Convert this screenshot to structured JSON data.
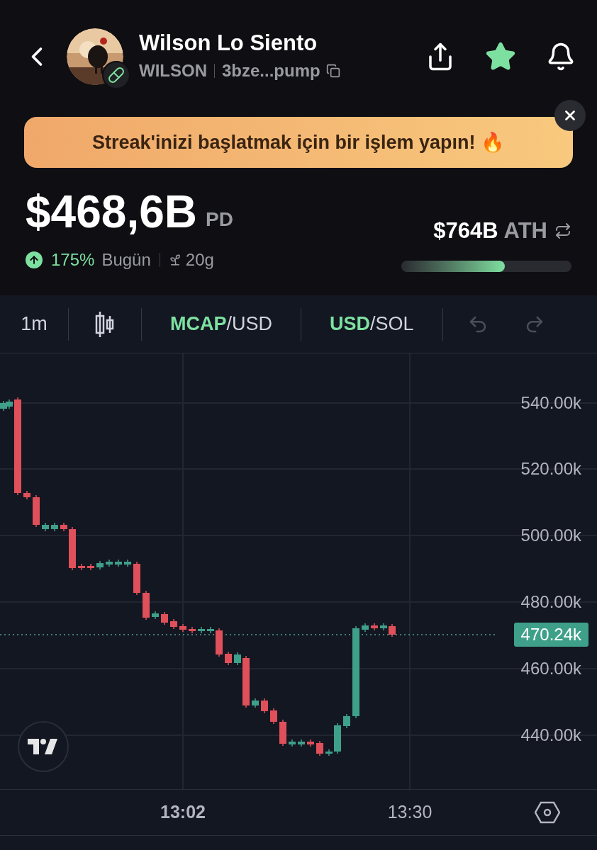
{
  "header": {
    "name": "Wilson Lo Siento",
    "ticker": "WILSON",
    "address": "3bze...pump",
    "favorite": true
  },
  "banner": {
    "text": "Streak'inizi başlatmak için bir işlem yapın! 🔥"
  },
  "stats": {
    "price": "$468,6B",
    "price_unit": "PD",
    "change": "175%",
    "change_period": "Bugün",
    "age": "20g",
    "ath_value": "$764B",
    "ath_label": "ATH",
    "ath_progress": {
      "level": 0.61
    }
  },
  "toolbar": {
    "interval": "1m",
    "pairs": [
      {
        "primary": "MCAP",
        "secondary": "/USD"
      },
      {
        "primary": "USD",
        "secondary": "/SOL"
      }
    ]
  },
  "chart": {
    "y_labels": [
      "540.00k",
      "520.00k",
      "500.00k",
      "480.00k",
      "460.00k",
      "440.00k"
    ],
    "last_price": "470.24k",
    "x_labels": [
      {
        "text": "13:02",
        "bold": true
      },
      {
        "text": "13:30",
        "bold": false
      }
    ]
  }
}
